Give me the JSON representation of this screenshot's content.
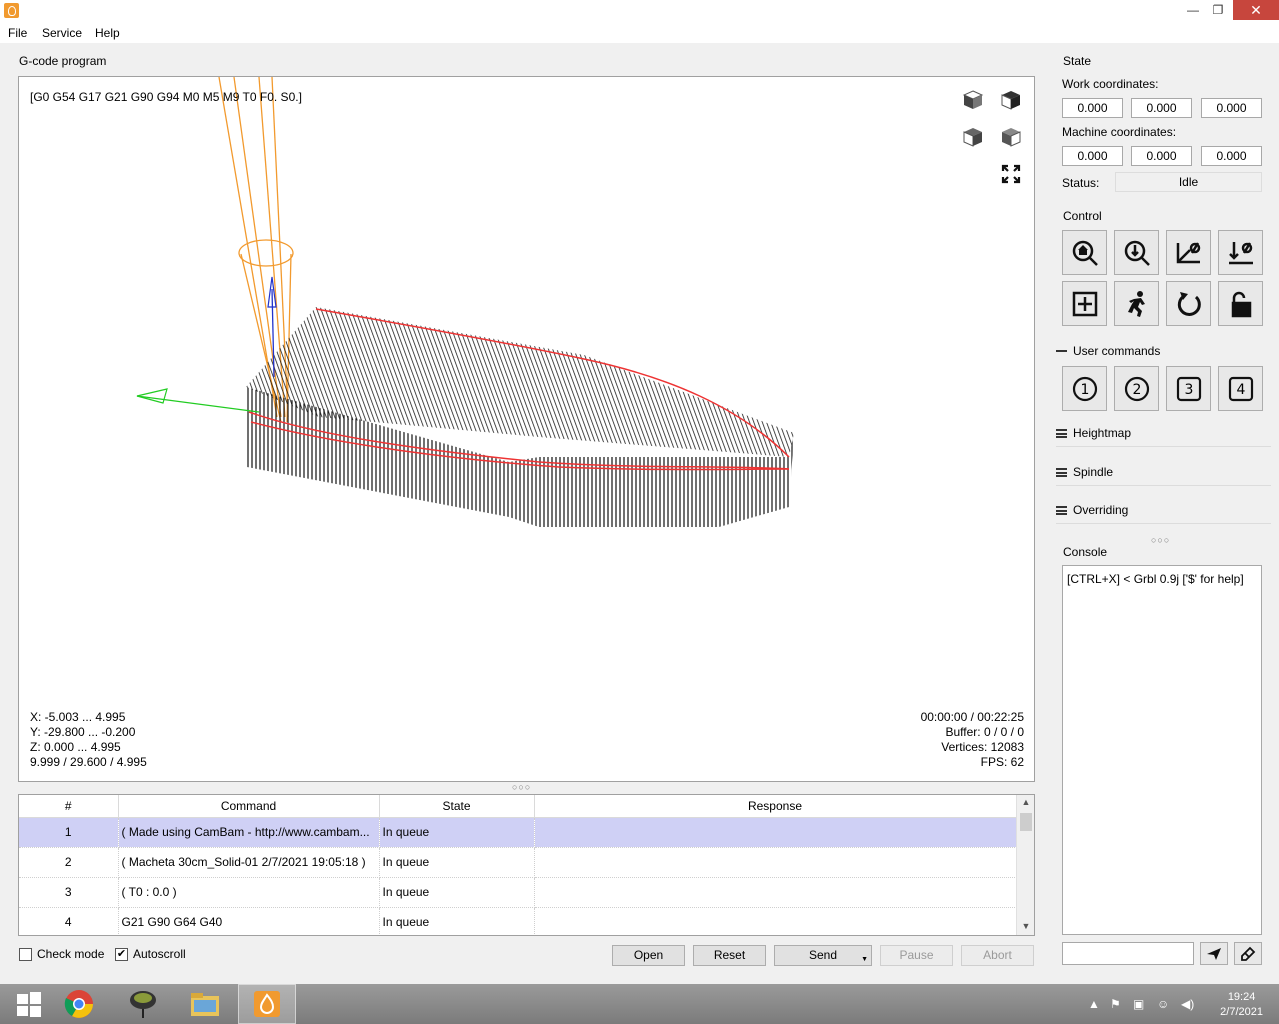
{
  "window": {
    "title": "",
    "min": "—",
    "max": "❐",
    "close": "✕"
  },
  "menu": [
    "File",
    "Service",
    "Help"
  ],
  "gcode_panel": {
    "title": "G-code program",
    "modal_state": "[G0 G54 G17 G21 G90 G94 M0 M5 M9 T0 F0. S0.]",
    "bounds": {
      "x": "X: -5.003 ... 4.995",
      "y": "Y: -29.800 ... -0.200",
      "z": "Z: 0.000 ... 4.995",
      "size": "9.999 / 29.600 / 4.995"
    },
    "stats": {
      "time": "00:00:00 / 00:22:25",
      "buffer": "Buffer: 0 / 0 / 0",
      "vertices": "Vertices: 12083",
      "fps": "FPS: 62"
    }
  },
  "table": {
    "headers": [
      "#",
      "Command",
      "State",
      "Response"
    ],
    "rows": [
      {
        "num": "1",
        "command": "( Made using CamBam - http://www.cambam...",
        "state": "In queue",
        "response": ""
      },
      {
        "num": "2",
        "command": "( Macheta 30cm_Solid-01 2/7/2021 19:05:18 )",
        "state": "In queue",
        "response": ""
      },
      {
        "num": "3",
        "command": "( T0 : 0.0 )",
        "state": "In queue",
        "response": ""
      },
      {
        "num": "4",
        "command": "G21 G90 G64 G40",
        "state": "In queue",
        "response": ""
      }
    ]
  },
  "bottom": {
    "check_mode": "Check mode",
    "autoscroll": "Autoscroll",
    "open": "Open",
    "reset": "Reset",
    "send": "Send",
    "pause": "Pause",
    "abort": "Abort"
  },
  "state_panel": {
    "title": "State",
    "work_label": "Work coordinates:",
    "work": [
      "0.000",
      "0.000",
      "0.000"
    ],
    "machine_label": "Machine coordinates:",
    "machine": [
      "0.000",
      "0.000",
      "0.000"
    ],
    "status_label": "Status:",
    "status": "Idle"
  },
  "control": {
    "title": "Control"
  },
  "user_commands": {
    "title": "User commands",
    "buttons": [
      "1",
      "2",
      "3",
      "4"
    ]
  },
  "sections": {
    "heightmap": "Heightmap",
    "spindle": "Spindle",
    "overriding": "Overriding"
  },
  "console": {
    "title": "Console",
    "text": "[CTRL+X] < Grbl 0.9j ['$' for help]"
  },
  "taskbar": {
    "time": "19:24",
    "date": "2/7/2021"
  }
}
